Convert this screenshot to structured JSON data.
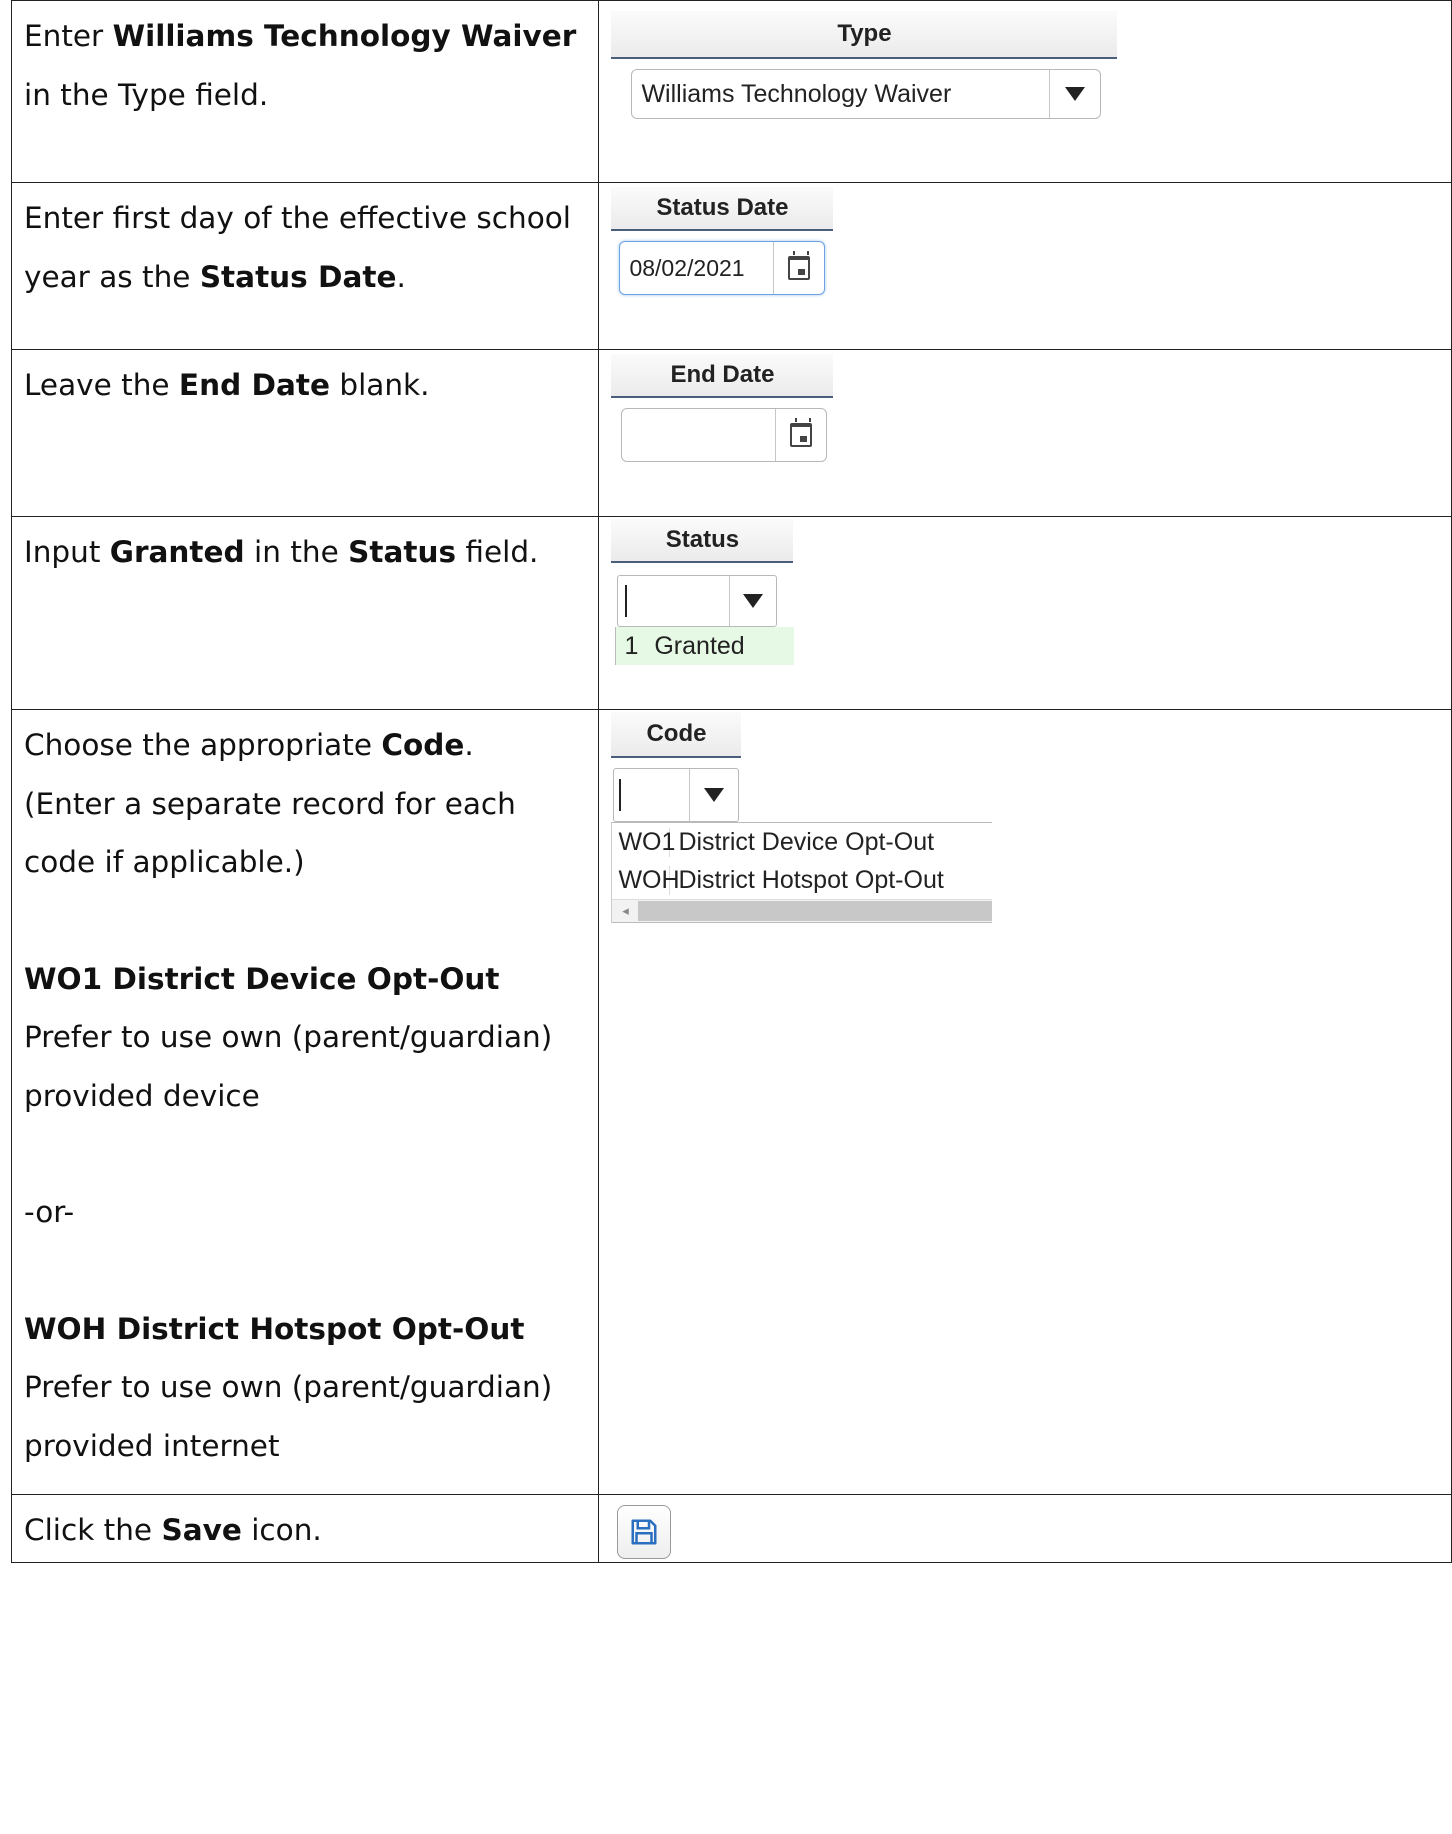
{
  "steps": [
    {
      "instruction": {
        "pre": "Enter ",
        "bold1": "Williams Technology Waiver",
        "mid": " in the Type field."
      },
      "ui": {
        "header": "Type",
        "value": "Williams Technology Waiver",
        "button_icon": "dropdown-arrow-icon"
      }
    },
    {
      "instruction": {
        "pre": "Enter first day of the effective school year as the ",
        "bold1": "Status Date",
        "post": "."
      },
      "ui": {
        "header": "Status Date",
        "value": "08/02/2021",
        "button_icon": "calendar-icon"
      }
    },
    {
      "instruction": {
        "pre": "Leave the ",
        "bold1": "End Date",
        "post": " blank."
      },
      "ui": {
        "header": "End Date",
        "value": "",
        "button_icon": "calendar-icon"
      }
    },
    {
      "instruction": {
        "pre": "Input ",
        "bold1": "Granted",
        "mid": " in the ",
        "bold2": "Status",
        "post": " field."
      },
      "ui": {
        "header": "Status",
        "value": "",
        "button_icon": "dropdown-arrow-icon",
        "options": [
          {
            "code": "1",
            "label": "Granted"
          }
        ]
      }
    },
    {
      "instruction": {
        "pre": "Choose the appropriate ",
        "bold1": "Code",
        "post": ".",
        "note": "(Enter a separate record for each code if applicable.)",
        "opt1_title": "WO1 District Device Opt-Out",
        "opt1_desc": "Prefer to use own (parent/guardian) provided device",
        "or": "-or-",
        "opt2_title": "WOH District Hotspot Opt-Out",
        "opt2_desc": "Prefer to use own (parent/guardian) provided internet"
      },
      "ui": {
        "header": "Code",
        "value": "",
        "button_icon": "dropdown-arrow-icon",
        "options": [
          {
            "code": "WO1",
            "label": "District Device Opt-Out"
          },
          {
            "code": "WOH",
            "label": "District Hotspot Opt-Out"
          }
        ]
      }
    },
    {
      "instruction": {
        "pre": "Click the ",
        "bold1": "Save",
        "post": " icon."
      },
      "ui": {
        "button_icon": "save-icon"
      }
    }
  ],
  "colors": {
    "table_border": "#222222",
    "header_underline": "#4a5d7a",
    "focus_border": "#6fa3df",
    "option_highlight": "#e6f9e4",
    "save_icon": "#2a6fc0"
  }
}
